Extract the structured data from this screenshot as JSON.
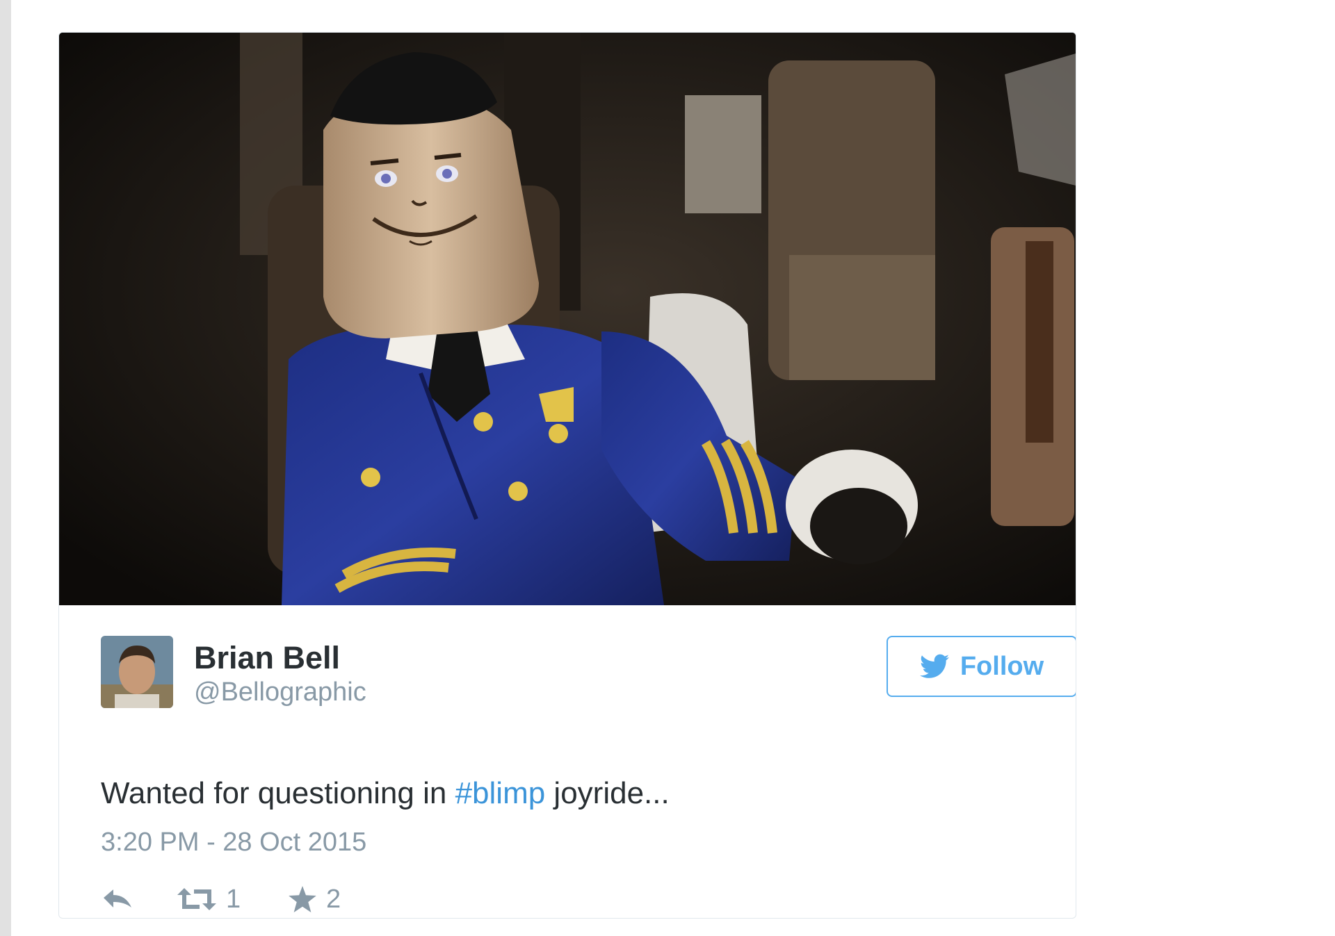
{
  "tweet": {
    "author": {
      "display_name": "Brian Bell",
      "handle": "@Bellographic"
    },
    "follow_label": "Follow",
    "text": {
      "before": "Wanted for questioning in ",
      "hashtag": "#blimp",
      "after": " joyride..."
    },
    "timestamp": "3:20 PM - 28 Oct 2015",
    "actions": {
      "retweet_count": "1",
      "favorite_count": "2"
    }
  },
  "colors": {
    "accent": "#55acee",
    "hashtag": "#3b94d9",
    "primary_text": "#292f33",
    "secondary_text": "#8899a6",
    "card_border": "#e1e8ed"
  },
  "icons": {
    "follow": "twitter-bird-icon",
    "reply": "reply-icon",
    "retweet": "retweet-icon",
    "favorite": "star-icon"
  }
}
